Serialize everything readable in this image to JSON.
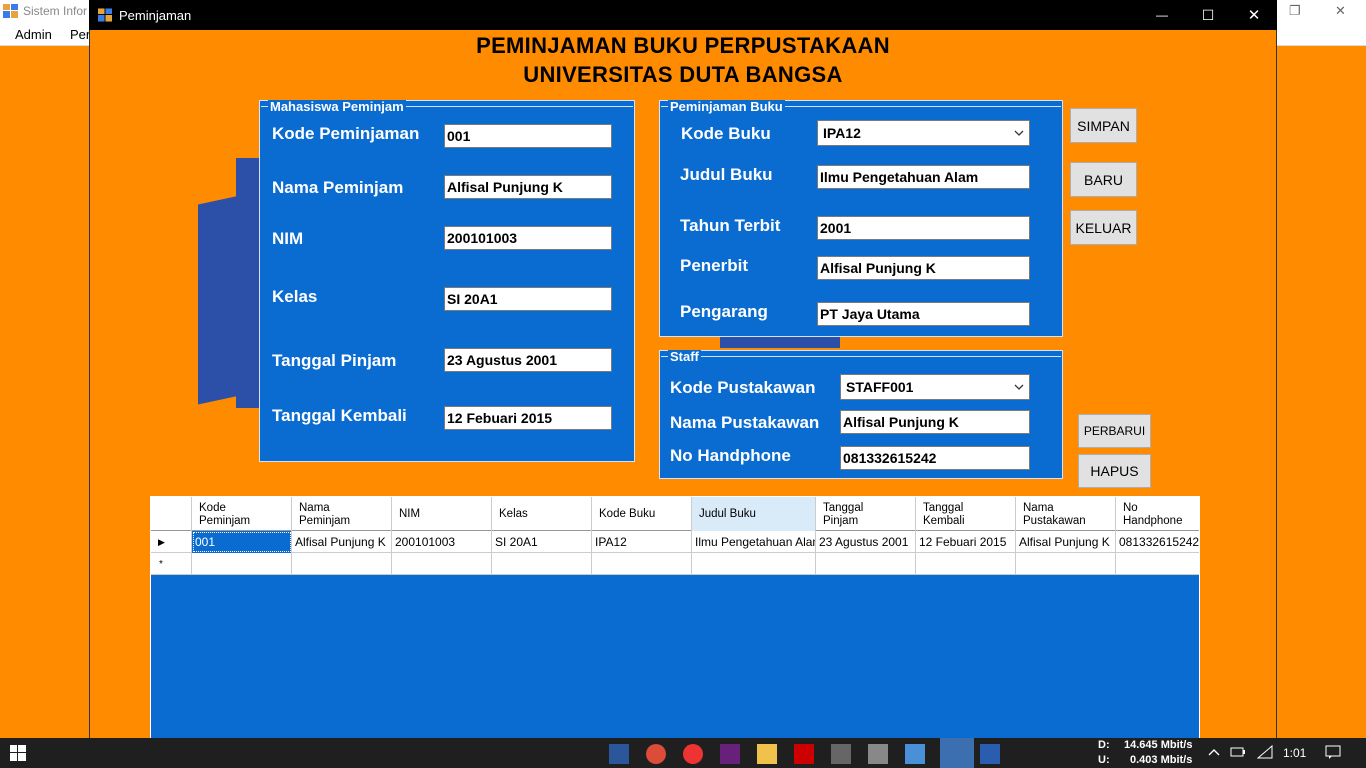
{
  "parent_window": {
    "title": "Sistem Infor",
    "menu": [
      "Admin",
      "Per"
    ]
  },
  "window": {
    "title": "Peminjaman",
    "minimize": "—",
    "maximize": "☐",
    "close": "✕"
  },
  "heading": {
    "line1": "PEMINJAMAN BUKU PERPUSTAKAAN",
    "line2": "UNIVERSITAS DUTA BANGSA"
  },
  "mahasiswa": {
    "legend": "Mahasiswa Peminjam",
    "kode_label": "Kode Peminjaman",
    "kode_value": "001",
    "nama_label": "Nama Peminjam",
    "nama_value": "Alfisal Punjung K",
    "nim_label": "NIM",
    "nim_value": "200101003",
    "kelas_label": "Kelas",
    "kelas_value": "SI 20A1",
    "pinjam_label": "Tanggal Pinjam",
    "pinjam_value": "23 Agustus 2001",
    "kembali_label": "Tanggal Kembali",
    "kembali_value": "12 Febuari 2015"
  },
  "buku": {
    "legend": "Peminjaman Buku",
    "kode_label": "Kode Buku",
    "kode_value": "IPA12",
    "judul_label": "Judul Buku",
    "judul_value": "Ilmu Pengetahuan Alam",
    "tahun_label": "Tahun Terbit",
    "tahun_value": "2001",
    "penerbit_label": "Penerbit",
    "penerbit_value": "Alfisal Punjung K",
    "pengarang_label": "Pengarang",
    "pengarang_value": "PT Jaya Utama"
  },
  "staff": {
    "legend": "Staff",
    "kode_label": "Kode Pustakawan",
    "kode_value": "STAFF001",
    "nama_label": "Nama Pustakawan",
    "nama_value": "Alfisal Punjung K",
    "hp_label": "No Handphone",
    "hp_value": "081332615242"
  },
  "buttons": {
    "simpan": "SIMPAN",
    "baru": "BARU",
    "keluar": "KELUAR",
    "perbarui": "PERBARUI",
    "hapus": "HAPUS"
  },
  "grid": {
    "columns": [
      [
        "Kode",
        "Peminjam"
      ],
      [
        "Nama",
        "Peminjam"
      ],
      [
        "NIM",
        ""
      ],
      [
        "Kelas",
        ""
      ],
      [
        "Kode Buku",
        ""
      ],
      [
        "Judul Buku",
        ""
      ],
      [
        "Tanggal",
        "Pinjam"
      ],
      [
        "Tanggal",
        "Kembali"
      ],
      [
        "Nama",
        "Pustakawan"
      ],
      [
        "No",
        "Handphone"
      ]
    ],
    "rows": [
      [
        "001",
        "Alfisal Punjung K",
        "200101003",
        "SI 20A1",
        "IPA12",
        "Ilmu Pengetahuan Alam",
        "23 Agustus 2001",
        "12 Febuari 2015",
        "Alfisal Punjung K",
        "081332615242"
      ]
    ],
    "current_row_marker": "▶",
    "new_row_marker": "*"
  },
  "taskbar": {
    "net_d_label": "D:",
    "net_d_value": "14.645 Mbit/s",
    "net_u_label": "U:",
    "net_u_value": "0.403 Mbit/s",
    "clock": "1:01"
  },
  "colors": {
    "orange": "#ff8c00",
    "panel_blue": "#0a6bd1",
    "title_black": "#000000"
  }
}
